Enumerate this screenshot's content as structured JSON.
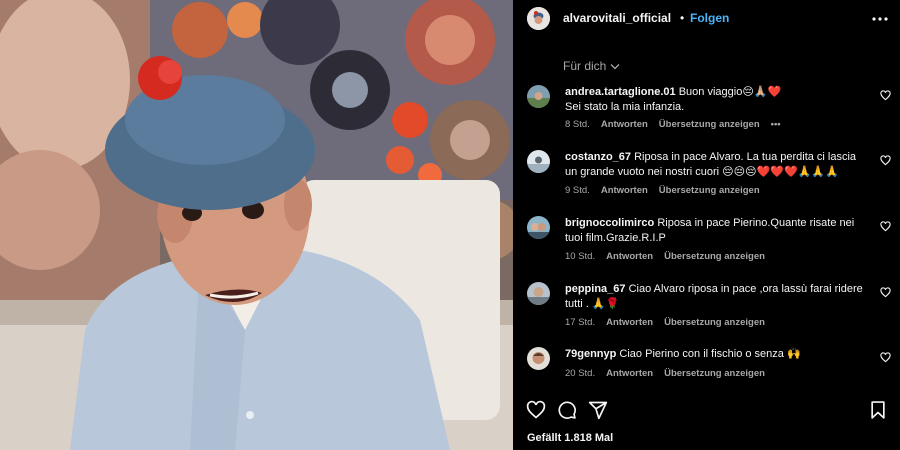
{
  "header": {
    "username": "alvarovitali_official",
    "separator": "•",
    "follow_label": "Folgen"
  },
  "sort": {
    "label": "Für dich"
  },
  "comments": [
    {
      "username": "andrea.tartaglione.01",
      "text_line1": "Buon viaggio😔🙏🏼❤️",
      "text_line2": "Sei stato la mia infanzia.",
      "time": "8 Std.",
      "reply_label": "Antworten",
      "translate_label": "Übersetzung anzeigen",
      "more": "•••"
    },
    {
      "username": "costanzo_67",
      "text": "Riposa in pace Alvaro. La tua perdita ci lascia un grande vuoto nei nostri cuori 😔😔😔❤️❤️❤️🙏🙏🙏",
      "time": "9 Std.",
      "reply_label": "Antworten",
      "translate_label": "Übersetzung anzeigen"
    },
    {
      "username": "brignoccolimirco",
      "text": "Riposa in pace Pierino.Quante risate nei tuoi film.Grazie.R.I.P",
      "time": "10 Std.",
      "reply_label": "Antworten",
      "translate_label": "Übersetzung anzeigen"
    },
    {
      "username": "peppina_67",
      "text": "Ciao Alvaro riposa in pace ,ora lassù farai ridere tutti . 🙏🌹",
      "time": "17 Std.",
      "reply_label": "Antworten",
      "translate_label": "Übersetzung anzeigen"
    },
    {
      "username": "79gennyp",
      "text": "Ciao Pierino con il fischio o senza 🙌",
      "time": "20 Std.",
      "reply_label": "Antworten",
      "translate_label": "Übersetzung anzeigen"
    }
  ],
  "likes": {
    "label": "Gefällt 1.818 Mal"
  },
  "icons": [
    "more-options-icon",
    "chevron-down-icon",
    "heart-icon",
    "comment-icon",
    "share-icon",
    "bookmark-icon"
  ],
  "colors": {
    "background": "#000000",
    "link": "#4cb5f9",
    "muted": "#a8a8a8",
    "text": "#f5f5f5"
  }
}
